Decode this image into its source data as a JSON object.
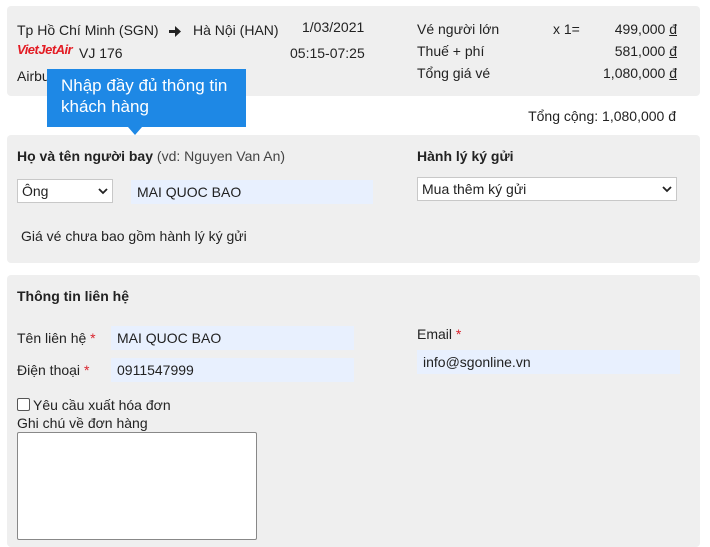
{
  "flight": {
    "origin": "Tp Hồ Chí Minh (SGN)",
    "destination": "Hà Nội (HAN)",
    "date": "1/03/2021",
    "airline_logo": "VietJetAir",
    "flight_number": "VJ 176",
    "time": "05:15-07:25",
    "aircraft_partial": "Airbu"
  },
  "fare": {
    "adult_label": "Vé người lớn",
    "adult_qty": "x 1=",
    "adult_price": "499,000",
    "tax_label": "Thuế + phí",
    "tax_price": "581,000",
    "total_label": "Tổng giá vé",
    "total_price": "1,080,000",
    "currency": "đ"
  },
  "grand_total": "Tổng cộng: 1,080,000 đ",
  "tooltip": "Nhập đầy đủ thông tin khách hàng",
  "passenger": {
    "name_label": "Họ và tên người bay",
    "name_hint": "(vd: Nguyen Van An)",
    "title_value": "Ông",
    "name_value": "MAI QUOC BAO",
    "baggage_label": "Hành lý ký gửi",
    "baggage_value": "Mua thêm ký gửi",
    "baggage_note": "Giá vé chưa bao gồm hành lý ký gửi"
  },
  "contact": {
    "section_title": "Thông tin liên hệ",
    "name_label": "Tên liên hệ",
    "name_value": "MAI QUOC BAO",
    "phone_label": "Điện thoại",
    "phone_value": "0911547999",
    "email_label": "Email",
    "email_value": "info@sgonline.vn",
    "required_mark": "*",
    "invoice_label": "Yêu cầu xuất hóa đơn",
    "note_label": "Ghi chú về đơn hàng",
    "note_value": ""
  },
  "icons": {
    "arrow": "arrow-right-icon",
    "chevron": "chevron-down-icon"
  },
  "colors": {
    "panel_bg": "#efefef",
    "tooltip_bg": "#1e88e5",
    "input_bg": "#e8f0fe",
    "required": "#d9232d",
    "brand": "#e31b23"
  }
}
